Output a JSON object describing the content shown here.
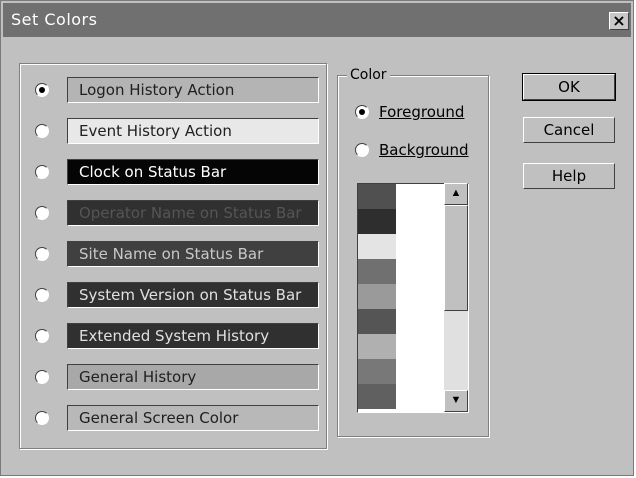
{
  "window": {
    "title": "Set Colors",
    "close_glyph": "×"
  },
  "options": [
    {
      "label": "Logon History Action",
      "selected": true,
      "bg": "#b4b4b4",
      "fg": "#202020"
    },
    {
      "label": "Event History Action",
      "selected": false,
      "bg": "#e8e8e8",
      "fg": "#202020"
    },
    {
      "label": "Clock on Status Bar",
      "selected": false,
      "bg": "#050505",
      "fg": "#ffffff"
    },
    {
      "label": "Operator Name on Status Bar",
      "selected": false,
      "bg": "#303030",
      "fg": "#555555"
    },
    {
      "label": "Site Name on Status Bar",
      "selected": false,
      "bg": "#404040",
      "fg": "#c8c8c8"
    },
    {
      "label": "System Version on Status Bar",
      "selected": false,
      "bg": "#303030",
      "fg": "#e0e0e0"
    },
    {
      "label": "Extended System History",
      "selected": false,
      "bg": "#303030",
      "fg": "#e0e0e0"
    },
    {
      "label": "General History",
      "selected": false,
      "bg": "#a8a8a8",
      "fg": "#202020"
    },
    {
      "label": "General Screen Color",
      "selected": false,
      "bg": "#b8b8b8",
      "fg": "#202020"
    }
  ],
  "color_group": {
    "legend": "Color",
    "foreground_label": "Foreground",
    "background_label": "Background",
    "foreground_selected": true,
    "swatches": [
      "#505050",
      "#2e2e2e",
      "#e4e4e4",
      "#707070",
      "#9a9a9a",
      "#555555",
      "#b0b0b0",
      "#787878",
      "#606060"
    ]
  },
  "buttons": {
    "ok": "OK",
    "cancel": "Cancel",
    "help": "Help"
  }
}
